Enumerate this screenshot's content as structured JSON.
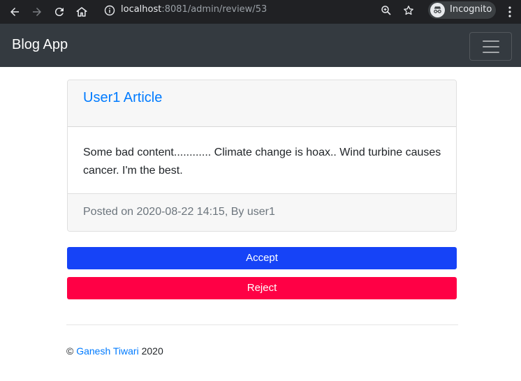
{
  "browser": {
    "url_host": "localhost",
    "url_rest": ":8081/admin/review/53",
    "incognito_label": "Incognito"
  },
  "navbar": {
    "brand": "Blog App"
  },
  "article": {
    "title": "User1 Article",
    "content": "Some bad content............ Climate change is hoax.. Wind turbine causes cancer. I'm the best.",
    "meta": "Posted on 2020-08-22 14:15, By user1"
  },
  "actions": {
    "accept_label": "Accept",
    "reject_label": "Reject",
    "accept_color": "#1643f7",
    "reject_color": "#ff0045"
  },
  "footer": {
    "copyright_symbol": "©",
    "author": "Ganesh Tiwari",
    "year": "2020"
  }
}
